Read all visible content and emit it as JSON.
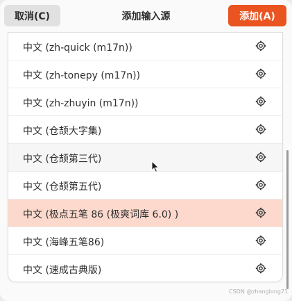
{
  "dialog": {
    "title": "添加输入源",
    "cancel_label": "取消(C)",
    "add_label": "添加(A)",
    "accent_color": "#e95420"
  },
  "list": {
    "items": [
      {
        "label": "中文 (zh-quick (m17n))",
        "icon": "settings-gear-icon"
      },
      {
        "label": "中文 (zh-tonepy (m17n))",
        "icon": "settings-gear-icon"
      },
      {
        "label": "中文 (zh-zhuyin (m17n))",
        "icon": "settings-gear-icon"
      },
      {
        "label": "中文 (仓颉大字集)",
        "icon": "settings-gear-icon"
      },
      {
        "label": "中文 (仓颉第三代)",
        "icon": "settings-gear-icon",
        "state": "hover"
      },
      {
        "label": "中文 (仓颉第五代)",
        "icon": "settings-gear-icon"
      },
      {
        "label": "中文 (极点五笔 86 (极爽词库 6.0) )",
        "icon": "settings-gear-icon",
        "state": "selected"
      },
      {
        "label": "中文 (海峰五笔86)",
        "icon": "settings-gear-icon"
      },
      {
        "label": "中文 (速成古典版)",
        "icon": "settings-gear-icon"
      }
    ]
  },
  "watermark": "CSDN @zhanglong71"
}
